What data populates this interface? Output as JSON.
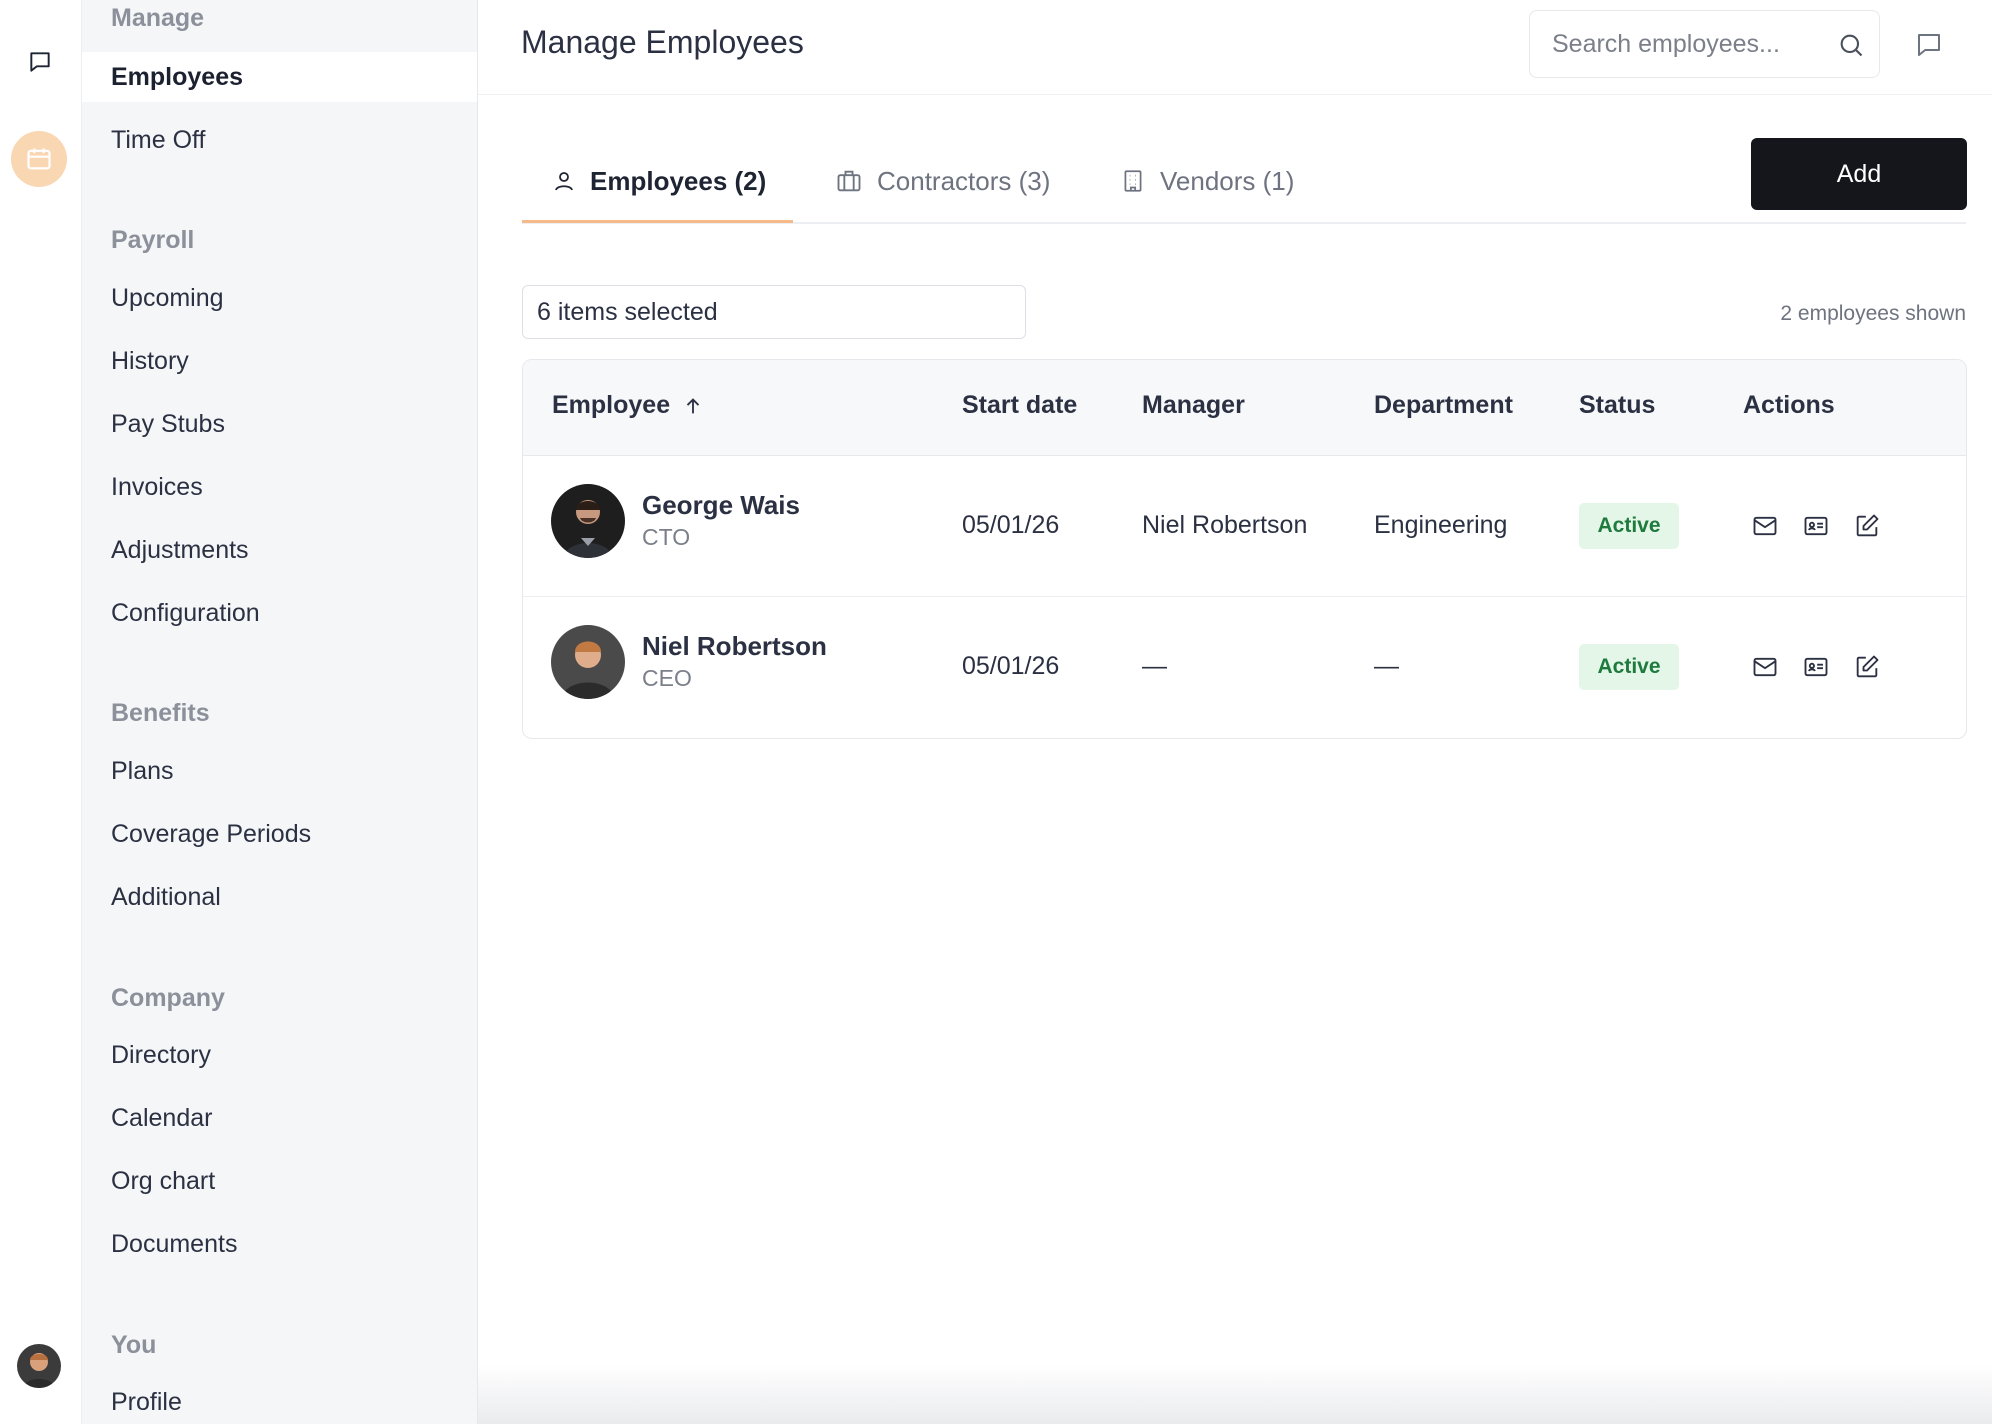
{
  "sidebar": {
    "sections": [
      {
        "title": "Manage",
        "items": [
          "Employees",
          "Time Off"
        ]
      },
      {
        "title": "Payroll",
        "items": [
          "Upcoming",
          "History",
          "Pay Stubs",
          "Invoices",
          "Adjustments",
          "Configuration"
        ]
      },
      {
        "title": "Benefits",
        "items": [
          "Plans",
          "Coverage Periods",
          "Additional"
        ]
      },
      {
        "title": "Company",
        "items": [
          "Directory",
          "Calendar",
          "Org chart",
          "Documents"
        ]
      },
      {
        "title": "You",
        "items": [
          "Profile"
        ]
      }
    ],
    "active_item": "Employees"
  },
  "header": {
    "title": "Manage Employees",
    "search_placeholder": "Search employees..."
  },
  "tabs": [
    {
      "label": "Employees (2)",
      "icon": "user-icon",
      "active": true
    },
    {
      "label": "Contractors (3)",
      "icon": "briefcase-icon",
      "active": false
    },
    {
      "label": "Vendors (1)",
      "icon": "building-icon",
      "active": false
    }
  ],
  "add_button": "Add",
  "filter": {
    "selection": "6 items selected",
    "count_text": "2 employees shown"
  },
  "table": {
    "columns": [
      "Employee",
      "Start date",
      "Manager",
      "Department",
      "Status",
      "Actions"
    ],
    "sort_icon": "arrow-up-icon",
    "rows": [
      {
        "name": "George Wais",
        "role": "CTO",
        "start_date": "05/01/26",
        "manager": "Niel Robertson",
        "department": "Engineering",
        "status": "Active"
      },
      {
        "name": "Niel Robertson",
        "role": "CEO",
        "start_date": "05/01/26",
        "manager": "—",
        "department": "—",
        "status": "Active"
      }
    ],
    "actions": [
      "mail-icon",
      "id-card-icon",
      "edit-icon"
    ]
  },
  "colors": {
    "accent_underline": "#f6b98a",
    "add_button_bg": "#14161b",
    "status_bg": "#e3f6e8",
    "status_text": "#1f7a3e",
    "rail_calendar_bg": "#fad7b3"
  }
}
